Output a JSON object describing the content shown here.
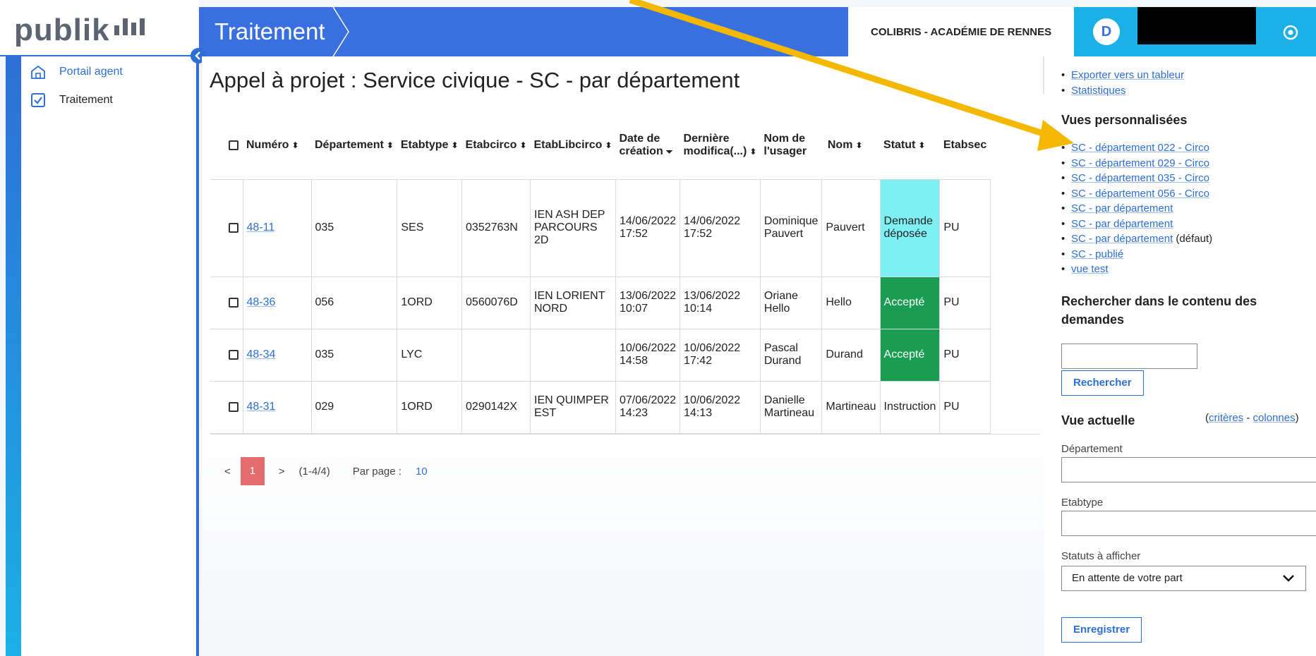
{
  "app": {
    "logo": "publik",
    "page_title": "Traitement",
    "organization": "COLIBRIS - ACADÉMIE DE RENNES",
    "user_initial": "D"
  },
  "nav": {
    "items": [
      {
        "label": "Portail agent",
        "icon": "house-icon"
      },
      {
        "label": "Traitement",
        "icon": "checkbox-icon"
      }
    ]
  },
  "main": {
    "heading": "Appel à projet : Service civique - SC - par département",
    "columns": [
      "Numéro",
      "Département",
      "Etabtype",
      "Etabcirco",
      "EtabLibcirco",
      "Date de création",
      "Dernière modifica(...)",
      "Nom de l'usager",
      "Nom",
      "Statut",
      "Etabsec"
    ],
    "columns_split": {
      "date_creation_1": "Date de",
      "date_creation_2": "création",
      "derniere_1": "Dernière",
      "derniere_2": "modifica(...)",
      "nom_usager_1": "Nom de",
      "nom_usager_2": "l'usager"
    },
    "rows": [
      {
        "numero": "48-11",
        "departement": "035",
        "etabtype": "SES",
        "etabcirco": "0352763N",
        "etablibcirco_1": "IEN ASH DEP",
        "etablibcirco_2": "PARCOURS 2D",
        "creation_date": "14/06/2022",
        "creation_time": "17:52",
        "modif_date": "14/06/2022",
        "modif_time": "17:52",
        "usager_1": "Dominique",
        "usager_2": "Pauvert",
        "nom": "Pauvert",
        "statut_1": "Demande",
        "statut_2": "déposée",
        "etabsec": "PU"
      },
      {
        "numero": "48-36",
        "departement": "056",
        "etabtype": "1ORD",
        "etabcirco": "0560076D",
        "etablibcirco_1": "IEN LORIENT",
        "etablibcirco_2": "NORD",
        "creation_date": "13/06/2022",
        "creation_time": "10:07",
        "modif_date": "13/06/2022",
        "modif_time": "10:14",
        "usager_1": "Oriane",
        "usager_2": "Hello",
        "nom": "Hello",
        "statut_1": "Accepté",
        "statut_2": "",
        "etabsec": "PU"
      },
      {
        "numero": "48-34",
        "departement": "035",
        "etabtype": "LYC",
        "etabcirco": "",
        "etablibcirco_1": "",
        "etablibcirco_2": "",
        "creation_date": "10/06/2022",
        "creation_time": "14:58",
        "modif_date": "10/06/2022",
        "modif_time": "17:42",
        "usager_1": "Pascal",
        "usager_2": "Durand",
        "nom": "Durand",
        "statut_1": "Accepté",
        "statut_2": "",
        "etabsec": "PU"
      },
      {
        "numero": "48-31",
        "departement": "029",
        "etabtype": "1ORD",
        "etabcirco": "0290142X",
        "etablibcirco_1": "IEN QUIMPER",
        "etablibcirco_2": "EST",
        "creation_date": "07/06/2022",
        "creation_time": "14:23",
        "modif_date": "10/06/2022",
        "modif_time": "14:13",
        "usager_1": "Danielle",
        "usager_2": "Martineau",
        "nom": "Martineau",
        "statut_1": "Instruction",
        "statut_2": "",
        "etabsec": "PU"
      }
    ],
    "pager": {
      "prev": "<",
      "current": "1",
      "next": ">",
      "range": "(1-4/4)",
      "per_page_label": "Par page :",
      "per_page": "10"
    }
  },
  "sidebar": {
    "top_links": [
      "Exporter vers un tableur",
      "Statistiques"
    ],
    "views_heading": "Vues personnalisées",
    "views": [
      "SC - département 022 - Circo",
      "SC - département 029 - Circo",
      "SC - département 035 - Circo",
      "SC - département 056 - Circo",
      "SC - par département",
      "SC - par département",
      "SC - par département",
      "SC - publié",
      "vue test"
    ],
    "default_suffix": "(défaut)",
    "search_heading": "Rechercher dans le contenu des demandes",
    "search_heading_1": "Rechercher dans le contenu des",
    "search_heading_2": "demandes",
    "search_button": "Rechercher",
    "current_view": "Vue actuelle",
    "criteria_link": "critères",
    "columns_link": "colonnes",
    "open_paren": "(",
    "dash": " - ",
    "close_paren": ")",
    "field_departement": "Département",
    "field_etabtype": "Etabtype",
    "field_statuts": "Statuts à afficher",
    "statuts_value": "En attente de votre part",
    "save_button": "Enregistrer"
  },
  "colors": {
    "primary": "#3a6fdf",
    "accent": "#1bb0e6",
    "deposee": "#7ef0f3",
    "accepte": "#1a9d52",
    "arrow": "#f5b800",
    "pager_current": "#e36c6c"
  }
}
